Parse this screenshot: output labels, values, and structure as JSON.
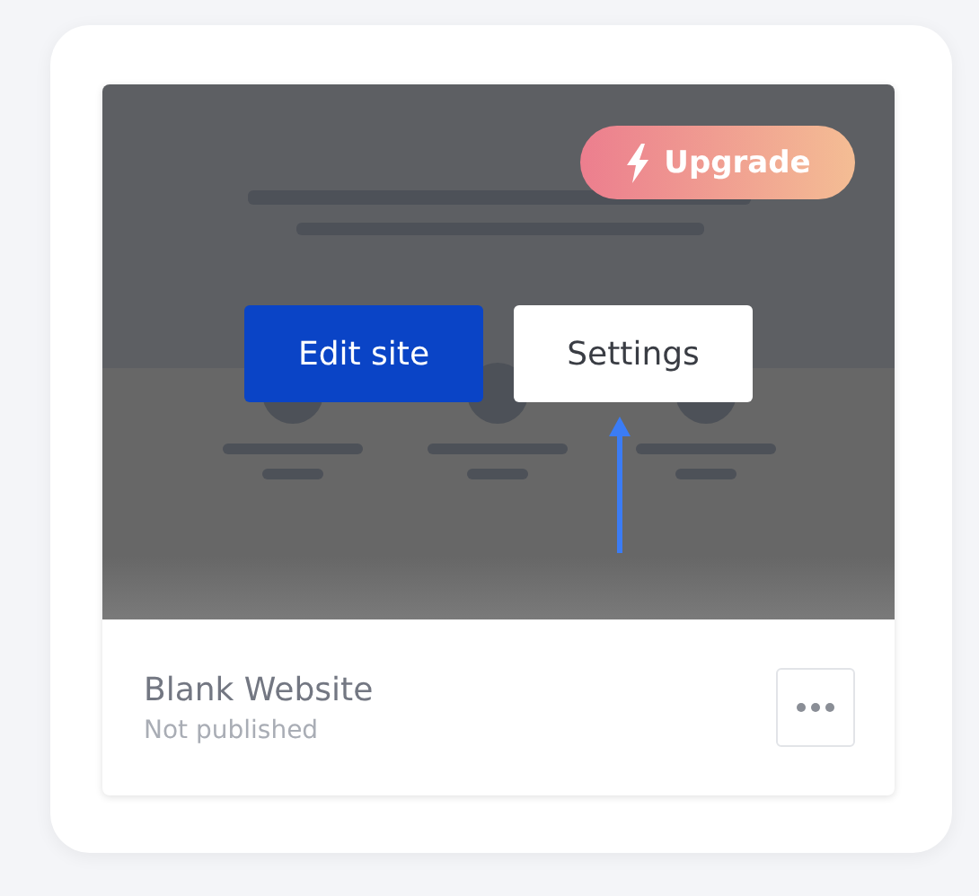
{
  "card": {
    "upgrade_badge": "Upgrade",
    "actions": [
      {
        "label": "Edit site",
        "kind": "primary"
      },
      {
        "label": "Settings",
        "kind": "secondary"
      }
    ],
    "site_name": "Blank Website",
    "status": "Not published"
  }
}
